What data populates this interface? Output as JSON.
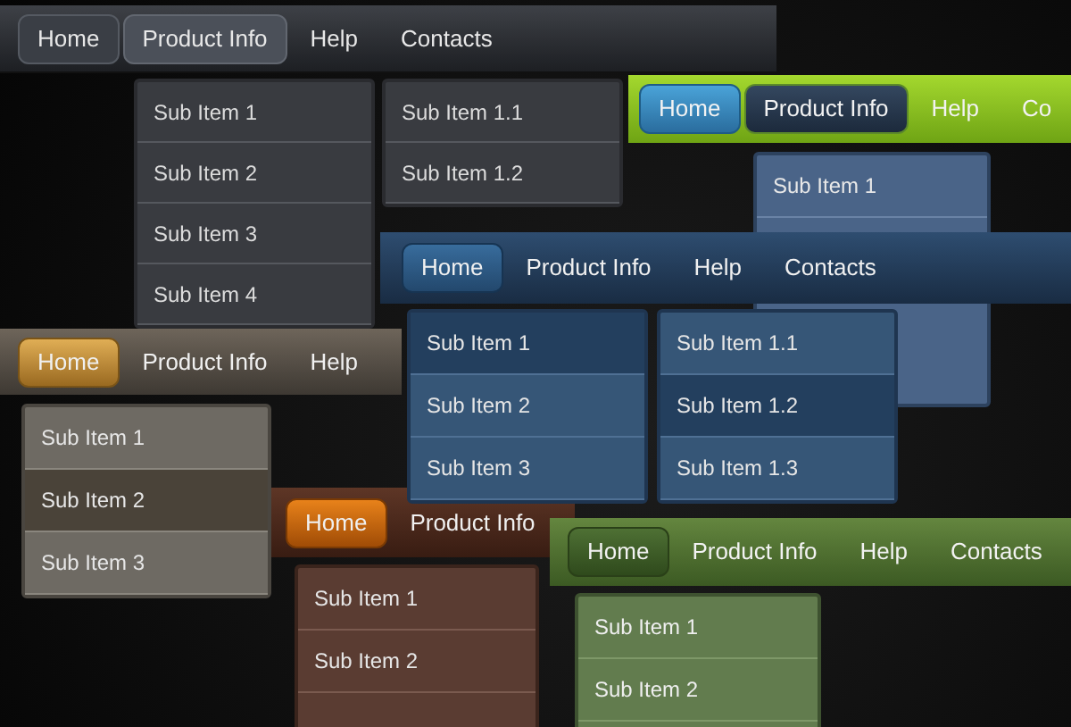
{
  "menus": [
    {
      "items": [
        {
          "label": "Home",
          "selected": true,
          "open": false
        },
        {
          "label": "Product Info",
          "selected": false,
          "open": true
        },
        {
          "label": "Help",
          "selected": false,
          "open": false
        },
        {
          "label": "Contacts",
          "selected": false,
          "open": false
        }
      ],
      "dropdown": {
        "columns": [
          [
            {
              "label": "Sub Item 1",
              "highlighted": false
            },
            {
              "label": "Sub Item 2",
              "highlighted": false
            },
            {
              "label": "Sub Item 3",
              "highlighted": false
            },
            {
              "label": "Sub Item 4",
              "highlighted": false
            }
          ],
          [
            {
              "label": "Sub Item 1.1",
              "highlighted": false
            },
            {
              "label": "Sub Item 1.2",
              "highlighted": false
            }
          ]
        ]
      }
    },
    {
      "items": [
        {
          "label": "Home",
          "selected": true,
          "open": false
        },
        {
          "label": "Product Info",
          "selected": false,
          "open": true
        },
        {
          "label": "Help",
          "selected": false,
          "open": false
        },
        {
          "label": "Co",
          "selected": false,
          "open": false
        }
      ],
      "dropdown": {
        "columns": [
          [
            {
              "label": "Sub Item 1",
              "highlighted": false
            }
          ]
        ]
      }
    },
    {
      "items": [
        {
          "label": "Home",
          "selected": true,
          "open": false
        },
        {
          "label": "Product Info",
          "selected": false,
          "open": false
        },
        {
          "label": "Help",
          "selected": false,
          "open": false
        },
        {
          "label": "Contacts",
          "selected": false,
          "open": false
        }
      ],
      "dropdown": {
        "columns": [
          [
            {
              "label": "Sub Item 1",
              "highlighted": true
            },
            {
              "label": "Sub Item 2",
              "highlighted": false
            },
            {
              "label": "Sub Item 3",
              "highlighted": false
            }
          ],
          [
            {
              "label": "Sub Item 1.1",
              "highlighted": false
            },
            {
              "label": "Sub Item 1.2",
              "highlighted": true
            },
            {
              "label": "Sub Item 1.3",
              "highlighted": false
            }
          ]
        ]
      }
    },
    {
      "items": [
        {
          "label": "Home",
          "selected": true,
          "open": false
        },
        {
          "label": "Product Info",
          "selected": false,
          "open": false
        },
        {
          "label": "Help",
          "selected": false,
          "open": false
        }
      ],
      "dropdown": {
        "columns": [
          [
            {
              "label": "Sub Item 1",
              "highlighted": false
            },
            {
              "label": "Sub Item 2",
              "highlighted": true
            },
            {
              "label": "Sub Item 3",
              "highlighted": false
            }
          ]
        ]
      }
    },
    {
      "items": [
        {
          "label": "Home",
          "selected": true,
          "open": false
        },
        {
          "label": "Product Info",
          "selected": false,
          "open": false
        }
      ],
      "dropdown": {
        "columns": [
          [
            {
              "label": "Sub Item 1",
              "highlighted": false
            },
            {
              "label": "Sub Item 2",
              "highlighted": false
            }
          ]
        ]
      }
    },
    {
      "items": [
        {
          "label": "Home",
          "selected": true,
          "open": false
        },
        {
          "label": "Product Info",
          "selected": false,
          "open": false
        },
        {
          "label": "Help",
          "selected": false,
          "open": false
        },
        {
          "label": "Contacts",
          "selected": false,
          "open": false
        }
      ],
      "dropdown": {
        "columns": [
          [
            {
              "label": "Sub Item 1",
              "highlighted": false
            },
            {
              "label": "Sub Item 2",
              "highlighted": false
            }
          ]
        ]
      }
    }
  ]
}
